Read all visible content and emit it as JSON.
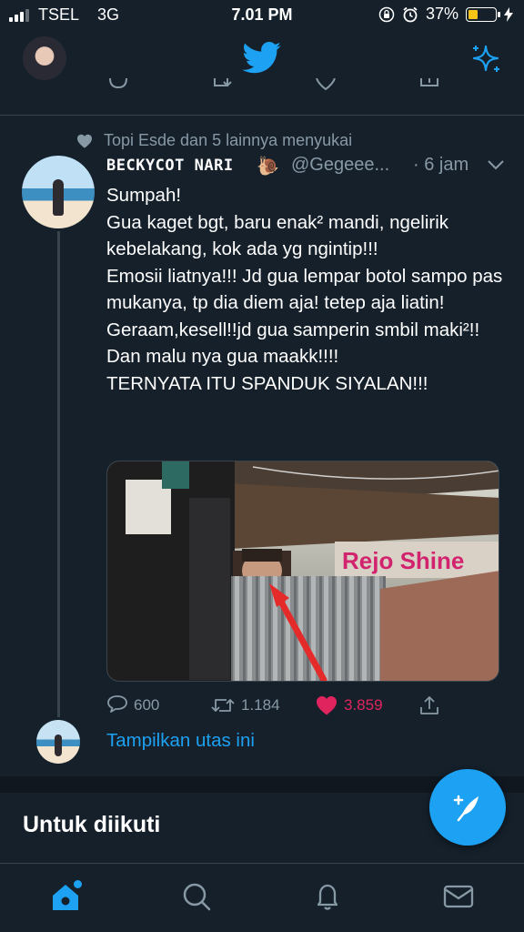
{
  "status_bar": {
    "carrier": "TSEL",
    "network": "3G",
    "time": "7.01 PM",
    "battery_percent": "37%",
    "battery_level": 0.37,
    "battery_color": "#f5c518"
  },
  "header": {
    "logo_icon": "twitter-bird-icon",
    "sparkle_icon": "sparkle-icon"
  },
  "tweet": {
    "social_context": "Topi Esde dan 5 lainnya menyukai",
    "author_name": "BECKYCOT NARI",
    "author_emoji": "🐌",
    "handle": "@Gegeee...",
    "time": "· 6 jam",
    "text": "Sumpah!\nGua kaget bgt, baru enak² mandi, ngelirik kebelakang, kok ada yg ngintip!!!\nEmosii liatnya!!! Jd gua lempar botol sampo pas mukanya, tp dia diem aja! tetep aja liatin!\nGeraam,kesell!!jd gua samperin smbil maki²!!\nDan malu nya gua maakk!!!!\nTERNYATA ITU SPANDUK SIYALAN!!!",
    "replies": "600",
    "retweets": "1.184",
    "likes": "3.859",
    "liked": true,
    "like_color": "#e0245e"
  },
  "thread": {
    "show_thread_label": "Tampilkan utas ini"
  },
  "section": {
    "title": "Untuk diikuti"
  },
  "accent_color": "#1da1f2",
  "tabs": [
    {
      "name": "home",
      "icon": "home-icon",
      "active": true
    },
    {
      "name": "search",
      "icon": "search-icon",
      "active": false
    },
    {
      "name": "notifications",
      "icon": "bell-icon",
      "active": false
    },
    {
      "name": "messages",
      "icon": "mail-icon",
      "active": false
    }
  ]
}
